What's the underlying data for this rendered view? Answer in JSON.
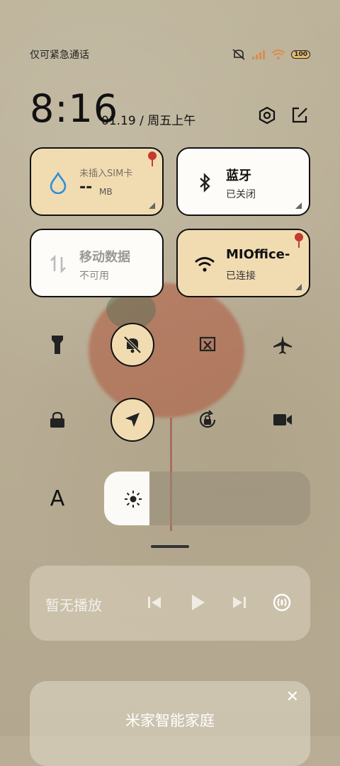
{
  "status_bar": {
    "carrier": "仅可紧急通话",
    "battery": "100"
  },
  "header": {
    "time": "8:16",
    "date": "01.19 / 周五上午"
  },
  "tiles": {
    "data_usage": {
      "title": "未插入SIM卡",
      "value": "--",
      "unit": "MB"
    },
    "bluetooth": {
      "title": "蓝牙",
      "status": "已关闭"
    },
    "mobile_data": {
      "title": "移动数据",
      "status": "不可用"
    },
    "wifi": {
      "title": "MIOffice-",
      "status": "已连接"
    }
  },
  "brightness": {
    "level": 0.22,
    "label_icon": "A"
  },
  "media": {
    "label": "暂无播放"
  },
  "card": {
    "title": "米家智能家庭"
  },
  "colors": {
    "accent_tile": "#f1dcb2",
    "white_tile": "#fdfcf8",
    "water_blue": "#2f8fd8"
  }
}
